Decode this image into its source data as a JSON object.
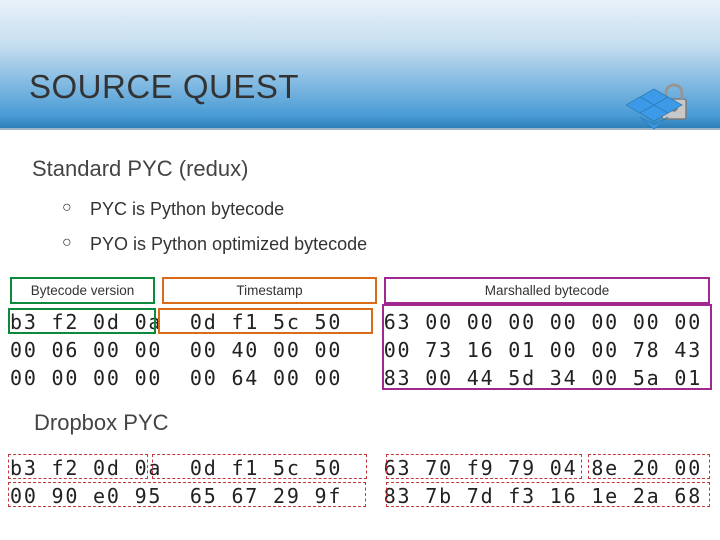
{
  "title": "SOURCE QUEST",
  "subtitle": "Standard PYC (redux)",
  "bullets": [
    "PYC is Python bytecode",
    "PYO is Python optimized bytecode"
  ],
  "labels": {
    "version": "Bytecode version",
    "timestamp": "Timestamp",
    "marshalled": "Marshalled bytecode"
  },
  "hex_standard": "b3 f2 0d 0a  0d f1 5c 50   63 00 00 00 00 00 00 00\n00 06 00 00  00 40 00 00   00 73 16 01 00 00 78 43\n00 00 00 00  00 64 00 00   83 00 44 5d 34 00 5a 01",
  "section2": "Dropbox PYC",
  "hex_dropbox": "b3 f2 0d 0a  0d f1 5c 50   63 70 f9 79 04 8e 20 00\n00 90 e0 95  65 67 29 9f   83 7b 7d f3 16 1e 2a 68"
}
